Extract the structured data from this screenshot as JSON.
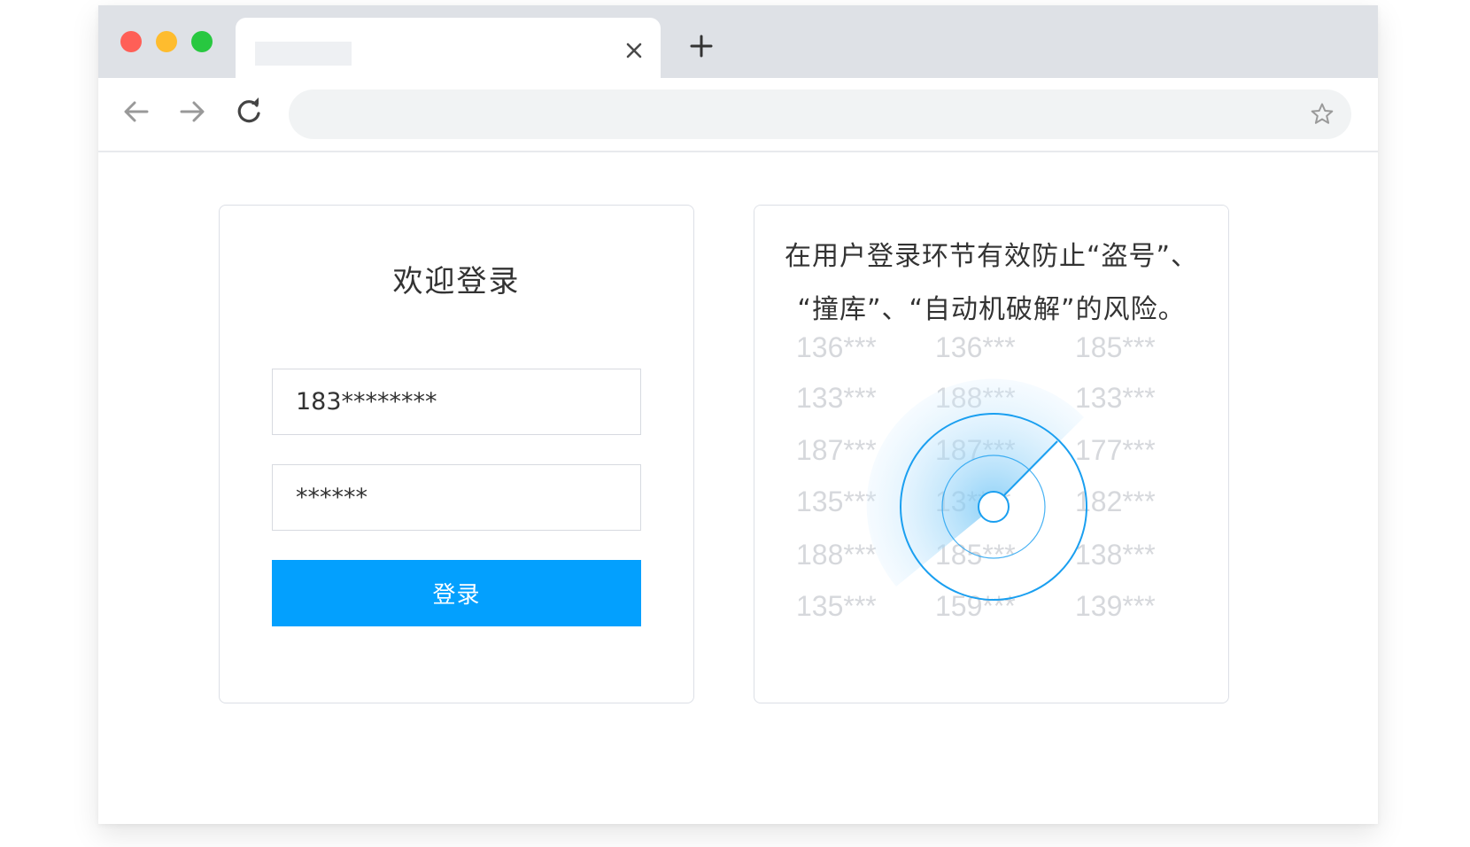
{
  "browser": {
    "icons": {
      "close": "close-icon",
      "new_tab": "plus-icon",
      "back": "arrow-left-icon",
      "forward": "arrow-right-icon",
      "reload": "reload-icon",
      "bookmark": "star-icon"
    },
    "colors": {
      "close_dot": "#ff5f57",
      "minimize_dot": "#febc2e",
      "maximize_dot": "#28c840"
    }
  },
  "login": {
    "title": "欢迎登录",
    "phone_value": "183********",
    "password_value": "******",
    "submit_label": "登录",
    "accent_color": "#03a0fe"
  },
  "risk": {
    "text": "在用户登录环节有效防止“盗号”、“撞库”、“自动机破解”的风险。",
    "numbers": [
      [
        "136***",
        "136***",
        "185***"
      ],
      [
        "133***",
        "188***",
        "133***"
      ],
      [
        "187***",
        "187***",
        "177***"
      ],
      [
        "135***",
        "13****",
        "182***"
      ],
      [
        "188***",
        "185***",
        "138***"
      ],
      [
        "135***",
        "159***",
        "139***"
      ]
    ],
    "radar_color": "#1a9ff0"
  }
}
